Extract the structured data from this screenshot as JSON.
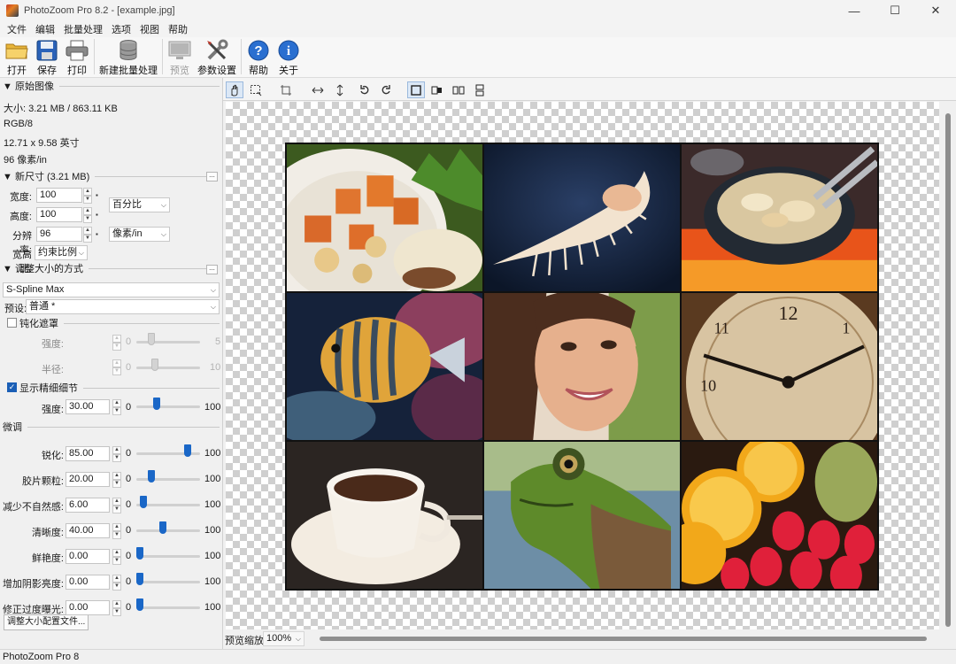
{
  "window": {
    "title": "PhotoZoom Pro 8.2 - [example.jpg]"
  },
  "menu": [
    "文件",
    "编辑",
    "批量处理",
    "选项",
    "视图",
    "帮助"
  ],
  "toolbar": {
    "open": "打开",
    "save": "保存",
    "print": "打印",
    "new_batch": "新建批量处理",
    "preview": "预览",
    "settings": "参数设置",
    "help": "帮助",
    "about": "关于"
  },
  "original": {
    "header": "▼ 原始图像",
    "size": "大小: 3.21 MB / 863.11 KB",
    "mode": "RGB/8",
    "dimensions": "12.71 x 9.58 英寸",
    "dpi": "96 像素/in"
  },
  "new_size": {
    "header": "▼ 新尺寸 (3.21 MB)",
    "width_label": "宽度:",
    "width_value": "100",
    "height_label": "高度:",
    "height_value": "100",
    "resolution_label": "分辨率:",
    "resolution_value": "96",
    "unit_select": "百分比",
    "resolution_unit": "像素/in",
    "aspect_label": "宽高比:",
    "aspect_value": "约束比例"
  },
  "method": {
    "header": "▼ 调整大小的方式",
    "algorithm": "S-Spline Max",
    "preset_label": "预设:",
    "preset_value": "普通 *"
  },
  "unsharp": {
    "label": "钝化遮罩",
    "checked": false,
    "strength_label": "强度:",
    "strength_min": "0",
    "strength_max": "5",
    "radius_label": "半径:",
    "radius_min": "0",
    "radius_max": "10"
  },
  "fine_detail": {
    "label": "显示精细细节",
    "checked": true,
    "strength_label": "强度:",
    "strength_value": "30.00",
    "min": "0",
    "max": "100",
    "level": 0.3
  },
  "tuning": {
    "header": "微调",
    "rows": [
      {
        "label": "锐化:",
        "value": "85.00",
        "min": "0",
        "max": "100",
        "level": 0.85
      },
      {
        "label": "胶片颗粒:",
        "value": "20.00",
        "min": "0",
        "max": "100",
        "level": 0.2
      },
      {
        "label": "减少不自然感:",
        "value": "6.00",
        "min": "0",
        "max": "100",
        "level": 0.06
      },
      {
        "label": "清晰度:",
        "value": "40.00",
        "min": "0",
        "max": "100",
        "level": 0.4
      },
      {
        "label": "鲜艳度:",
        "value": "0.00",
        "min": "0",
        "max": "100",
        "level": 0.0
      },
      {
        "label": "增加阴影亮度:",
        "value": "0.00",
        "min": "0",
        "max": "100",
        "level": 0.0
      },
      {
        "label": "修正过度曝光:",
        "value": "0.00",
        "min": "0",
        "max": "100",
        "level": 0.0
      }
    ]
  },
  "profile_button": "调整大小配置文件...",
  "preview_zoom": {
    "label": "预览缩放:",
    "value": "100%"
  },
  "status": "PhotoZoom Pro 8",
  "colors": {
    "accent": "#1a67c7",
    "checker": "#cfcfcf"
  }
}
